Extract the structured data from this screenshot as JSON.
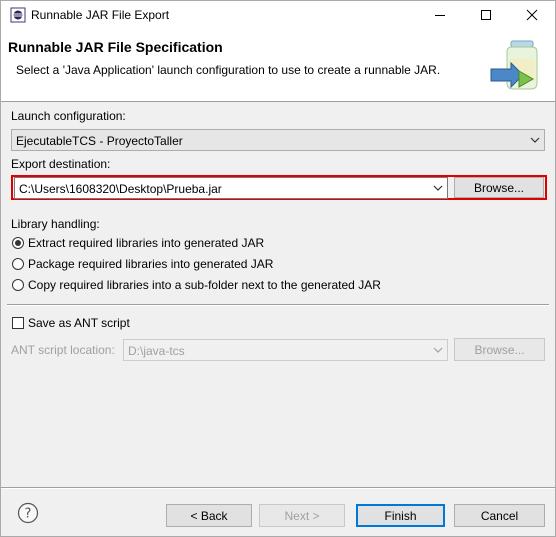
{
  "window": {
    "title": "Runnable JAR File Export"
  },
  "header": {
    "title": "Runnable JAR File Specification",
    "description": "Select a 'Java Application' launch configuration to use to create a runnable JAR."
  },
  "launch": {
    "label": "Launch configuration:",
    "value": "EjecutableTCS - ProyectoTaller"
  },
  "export": {
    "label": "Export destination:",
    "value": "C:\\Users\\1608320\\Desktop\\Prueba.jar",
    "browse_label": "Browse..."
  },
  "library": {
    "label": "Library handling:",
    "options": [
      {
        "label": "Extract required libraries into generated JAR",
        "selected": true
      },
      {
        "label": "Package required libraries into generated JAR",
        "selected": false
      },
      {
        "label": "Copy required libraries into a sub-folder next to the generated JAR",
        "selected": false
      }
    ]
  },
  "ant": {
    "checkbox_label": "Save as ANT script",
    "checked": false,
    "location_label": "ANT script location:",
    "location_value": "D:\\java-tcs",
    "browse_label": "Browse..."
  },
  "footer": {
    "back_label": "< Back",
    "next_label": "Next >",
    "finish_label": "Finish",
    "cancel_label": "Cancel"
  },
  "colors": {
    "highlight": "#e00000",
    "default_button_border": "#0078d7"
  }
}
